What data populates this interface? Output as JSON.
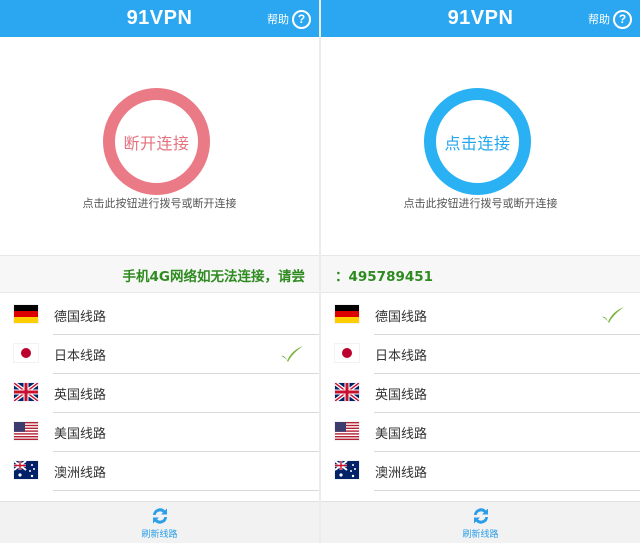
{
  "screens": [
    {
      "header": {
        "title": "91VPN",
        "help_label": "帮助",
        "help_icon": "question-circle-icon"
      },
      "connect": {
        "button_label": "断开连接",
        "state": "connected",
        "ring_color": "#ea7b86",
        "hint": "点击此按钮进行拨号或断开连接"
      },
      "marquee": {
        "text": "手机4G网络如无法连接，请尝"
      },
      "routes": [
        {
          "label": "德国线路",
          "flag": "de",
          "selected": false
        },
        {
          "label": "日本线路",
          "flag": "jp",
          "selected": true
        },
        {
          "label": "英国线路",
          "flag": "gb",
          "selected": false
        },
        {
          "label": "美国线路",
          "flag": "us",
          "selected": false
        },
        {
          "label": "澳洲线路",
          "flag": "au",
          "selected": false
        }
      ],
      "footer": {
        "refresh_label": "刷新线路",
        "refresh_icon": "refresh-icon"
      }
    },
    {
      "header": {
        "title": "91VPN",
        "help_label": "帮助",
        "help_icon": "question-circle-icon"
      },
      "connect": {
        "button_label": "点击连接",
        "state": "disconnected",
        "ring_color": "#29b1f4",
        "hint": "点击此按钮进行拨号或断开连接"
      },
      "marquee": {
        "text": "：495789451"
      },
      "routes": [
        {
          "label": "德国线路",
          "flag": "de",
          "selected": true
        },
        {
          "label": "日本线路",
          "flag": "jp",
          "selected": false
        },
        {
          "label": "英国线路",
          "flag": "gb",
          "selected": false
        },
        {
          "label": "美国线路",
          "flag": "us",
          "selected": false
        },
        {
          "label": "澳洲线路",
          "flag": "au",
          "selected": false
        }
      ],
      "footer": {
        "refresh_label": "刷新线路",
        "refresh_icon": "refresh-icon"
      }
    }
  ],
  "colors": {
    "header": "#2aa7f0",
    "marquee_text": "#2e8b1f",
    "check": "#7cb342",
    "refresh": "#2a9ee8"
  }
}
